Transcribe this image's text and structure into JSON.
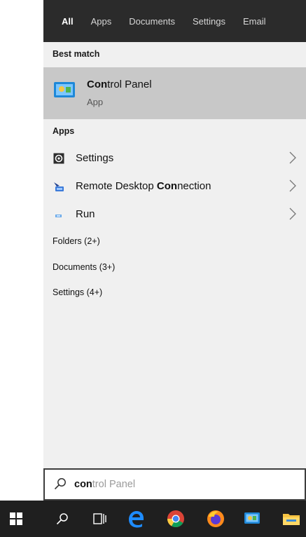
{
  "tabs": [
    "All",
    "Apps",
    "Documents",
    "Settings",
    "Email"
  ],
  "sections": {
    "best_match": "Best match",
    "apps": "Apps"
  },
  "best_match": {
    "title_bold": "Con",
    "title_rest": "trol Panel",
    "subtitle": "App",
    "icon": "control-panel-icon"
  },
  "apps": [
    {
      "before": "",
      "bold": "",
      "after": "Settings",
      "icon": "settings-gear-icon"
    },
    {
      "before": "Remote Desktop ",
      "bold": "Con",
      "after": "nection",
      "icon": "remote-desktop-icon"
    },
    {
      "before": "",
      "bold": "",
      "after": "Run",
      "icon": "run-icon"
    }
  ],
  "categories": [
    "Folders (2+)",
    "Documents (3+)",
    "Settings (4+)"
  ],
  "search": {
    "typed": "con",
    "suggestion": "trol Panel"
  },
  "taskbar": {
    "icons": [
      "windows-start-icon",
      "search-icon",
      "task-view-icon",
      "edge-icon",
      "chrome-icon",
      "firefox-icon",
      "control-panel-icon",
      "file-explorer-icon"
    ]
  },
  "colors": {
    "panel_bg": "#f0f0f0",
    "tabbar_bg": "#2b2b2b",
    "selected_bg": "#c8c8c8",
    "taskbar_bg": "#1f1f1f"
  }
}
